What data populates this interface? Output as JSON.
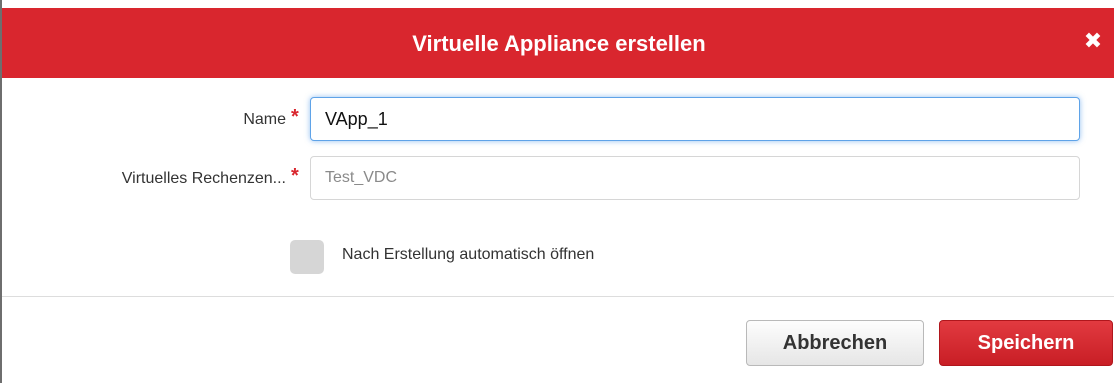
{
  "dialog": {
    "title": "Virtuelle Appliance erstellen",
    "close_glyph": "✖"
  },
  "form": {
    "name_label": "Name",
    "name_required": "*",
    "name_value": "VApp_1",
    "vdc_label": "Virtuelles Rechenzen...",
    "vdc_required": "*",
    "vdc_value": "Test_VDC",
    "auto_open_label": "Nach Erstellung automatisch öffnen"
  },
  "buttons": {
    "cancel_label": "Abbrechen",
    "save_label": "Speichern"
  },
  "colors": {
    "accent": "#d9262e",
    "focus": "#5fa3e8"
  },
  "icons": {
    "close": "close-icon"
  }
}
